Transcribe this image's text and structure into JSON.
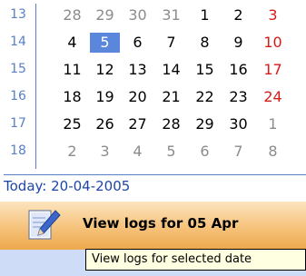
{
  "calendar": {
    "weeks": [
      {
        "week": "13",
        "days": [
          {
            "d": "28",
            "dim": true
          },
          {
            "d": "29",
            "dim": true
          },
          {
            "d": "30",
            "dim": true
          },
          {
            "d": "31",
            "dim": true
          },
          {
            "d": "1"
          },
          {
            "d": "2"
          },
          {
            "d": "3",
            "sun": true
          }
        ]
      },
      {
        "week": "14",
        "days": [
          {
            "d": "4"
          },
          {
            "d": "5",
            "sel": true
          },
          {
            "d": "6"
          },
          {
            "d": "7"
          },
          {
            "d": "8"
          },
          {
            "d": "9"
          },
          {
            "d": "10",
            "sun": true
          }
        ]
      },
      {
        "week": "15",
        "days": [
          {
            "d": "11"
          },
          {
            "d": "12"
          },
          {
            "d": "13"
          },
          {
            "d": "14"
          },
          {
            "d": "15"
          },
          {
            "d": "16"
          },
          {
            "d": "17",
            "sun": true
          }
        ]
      },
      {
        "week": "16",
        "days": [
          {
            "d": "18"
          },
          {
            "d": "19"
          },
          {
            "d": "20"
          },
          {
            "d": "21"
          },
          {
            "d": "22"
          },
          {
            "d": "23"
          },
          {
            "d": "24",
            "sun": true
          }
        ]
      },
      {
        "week": "17",
        "days": [
          {
            "d": "25"
          },
          {
            "d": "26"
          },
          {
            "d": "27"
          },
          {
            "d": "28"
          },
          {
            "d": "29"
          },
          {
            "d": "30"
          },
          {
            "d": "1",
            "dim": true,
            "sun": true
          }
        ]
      },
      {
        "week": "18",
        "days": [
          {
            "d": "2",
            "dim": true
          },
          {
            "d": "3",
            "dim": true
          },
          {
            "d": "4",
            "dim": true
          },
          {
            "d": "5",
            "dim": true
          },
          {
            "d": "6",
            "dim": true
          },
          {
            "d": "7",
            "dim": true
          },
          {
            "d": "8",
            "dim": true,
            "sun": true
          }
        ]
      }
    ]
  },
  "today_label": "Today: 20-04-2005",
  "view_logs_button": {
    "label": "View logs for 05 Apr",
    "icon": "edit-document-icon"
  },
  "tooltip": {
    "text": "View logs for selected date"
  },
  "colors": {
    "accent": "#5a86db",
    "sunday": "#d71a1a",
    "weeknum": "#5a7fc7"
  }
}
